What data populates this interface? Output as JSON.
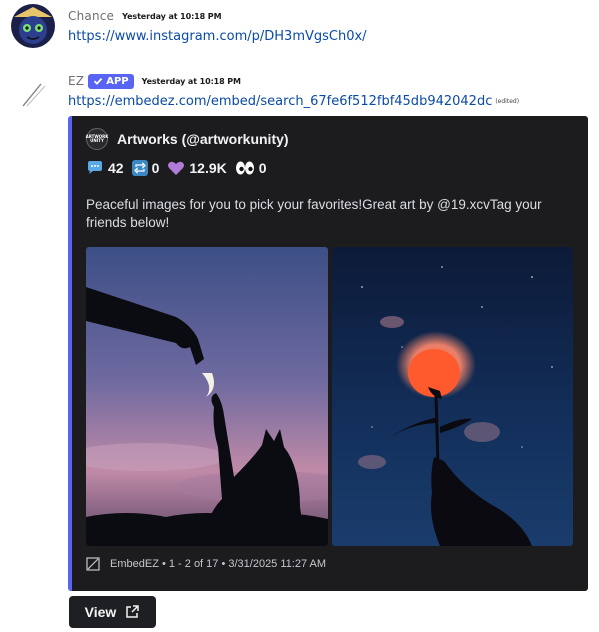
{
  "messages": [
    {
      "username": "Chance",
      "timestamp": "Yesterday at 10:18 PM",
      "link": "https://www.instagram.com/p/DH3mVgsCh0x/"
    },
    {
      "username": "EZ",
      "badge": "APP",
      "timestamp": "Yesterday at 10:18 PM",
      "link": "https://embedez.com/embed/search_67fe6f512fbf45db942042dc",
      "link_tag": "(edited)"
    }
  ],
  "embed": {
    "accent_color": "#5865f2",
    "author_icon_text": "ARTWORK UNITY",
    "author": "Artworks (@artworkunity)",
    "stats": [
      {
        "icon": "speech-bubble-icon",
        "value": "42"
      },
      {
        "icon": "repost-icon",
        "value": "0"
      },
      {
        "icon": "purple-heart-icon",
        "value": "12.9K"
      },
      {
        "icon": "eyes-icon",
        "value": "0"
      }
    ],
    "description": "Peaceful images for you to pick your favorites!Great art by @19.xcvTag your friends below!",
    "images": [
      {
        "icon": "hand-cat-moon-image"
      },
      {
        "icon": "hand-rose-cloud-image"
      }
    ],
    "footer": "EmbedEZ • 1 - 2 of 17 • 3/31/2025 11:27 AM",
    "footer_icon": "embedez-logo-icon"
  },
  "view_button": {
    "label": "View",
    "icon": "external-link-icon"
  }
}
